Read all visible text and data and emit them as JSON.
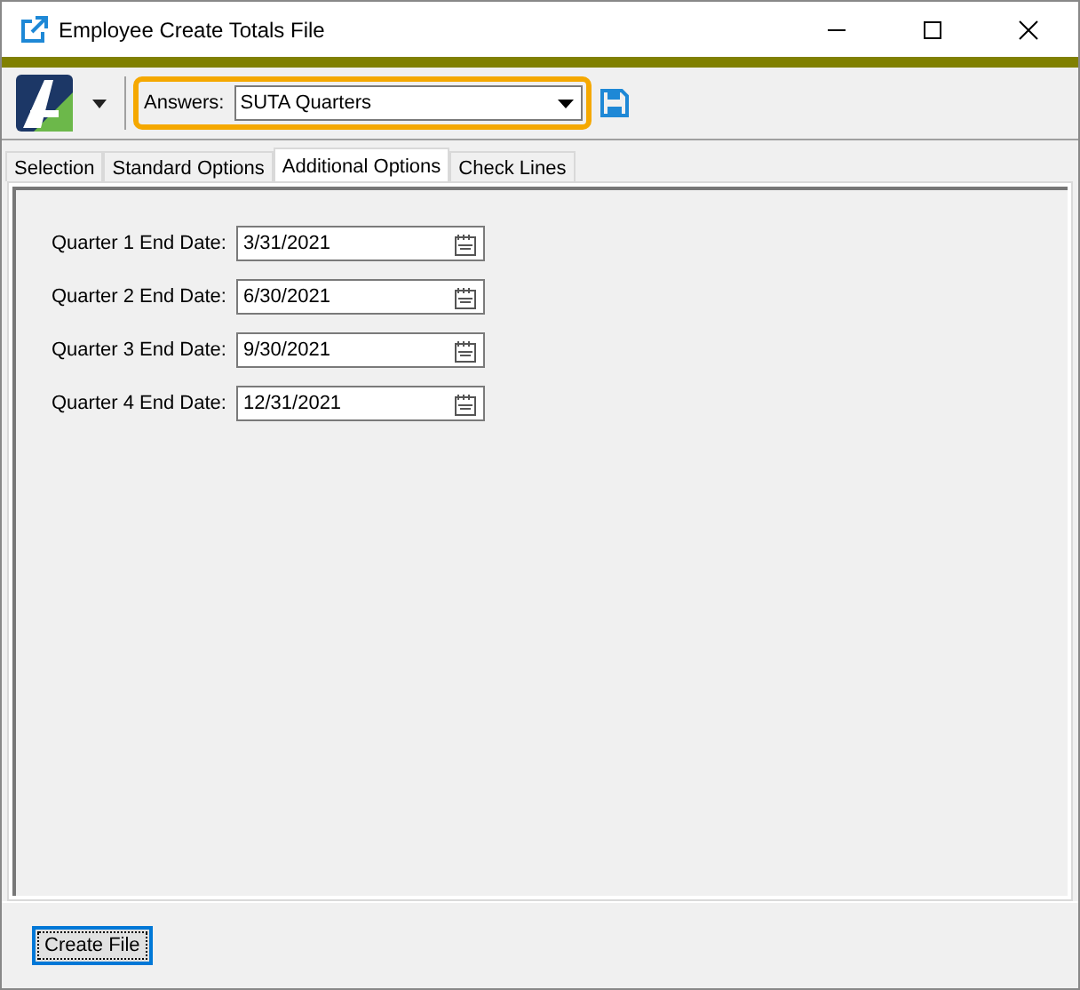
{
  "window": {
    "title": "Employee Create Totals File"
  },
  "toolbar": {
    "answers_label": "Answers:",
    "answers_value": "SUTA Quarters"
  },
  "tabs": [
    {
      "label": "Selection",
      "selected": false
    },
    {
      "label": "Standard Options",
      "selected": false
    },
    {
      "label": "Additional Options",
      "selected": true
    },
    {
      "label": "Check Lines",
      "selected": false
    }
  ],
  "fields": [
    {
      "label": "Quarter 1 End Date:",
      "value": "3/31/2021"
    },
    {
      "label": "Quarter 2 End Date:",
      "value": "6/30/2021"
    },
    {
      "label": "Quarter 3 End Date:",
      "value": "9/30/2021"
    },
    {
      "label": "Quarter 4 End Date:",
      "value": "12/31/2021"
    }
  ],
  "buttons": [
    "Create File"
  ]
}
